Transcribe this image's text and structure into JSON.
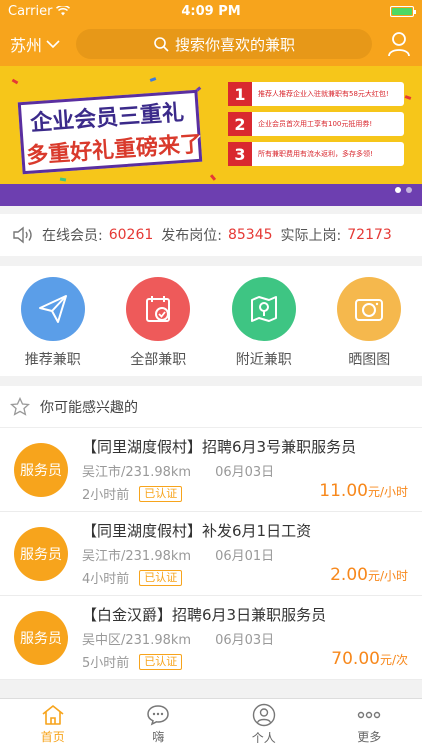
{
  "status": {
    "carrier": "Carrier",
    "time": "4:09 PM"
  },
  "header": {
    "city": "苏州",
    "search_placeholder": "搜索你喜欢的兼职"
  },
  "banner": {
    "title_line1": "企业会员三重礼",
    "title_line2": "多重好礼重磅来了",
    "items": [
      {
        "num": "1",
        "text": "推荐人推荐企业入驻就兼职有58元大红包!"
      },
      {
        "num": "2",
        "text": "企业会员首次用工享有100元抵用券!"
      },
      {
        "num": "3",
        "text": "所有兼职费用有流水返利，多存多领!"
      }
    ]
  },
  "stats": {
    "online_label": "在线会员:",
    "online_value": "60261",
    "posted_label": "发布岗位:",
    "posted_value": "85345",
    "actual_label": "实际上岗:",
    "actual_value": "72173"
  },
  "categories": [
    {
      "label": "推荐兼职",
      "color": "#5b9ee8",
      "icon": "paper-plane-icon"
    },
    {
      "label": "全部兼职",
      "color": "#ee5a5a",
      "icon": "calendar-check-icon"
    },
    {
      "label": "附近兼职",
      "color": "#3ec583",
      "icon": "map-pin-icon"
    },
    {
      "label": "晒图图",
      "color": "#f5b84d",
      "icon": "camera-icon"
    }
  ],
  "recommend": {
    "title": "你可能感兴趣的"
  },
  "jobs": [
    {
      "avatar": "服务员",
      "title": "【同里湖度假村】招聘6月3号兼职服务员",
      "location": "吴江市/231.98km",
      "date": "06月03日",
      "time": "2小时前",
      "badge": "已认证",
      "price": "11.00",
      "unit": "元/小时"
    },
    {
      "avatar": "服务员",
      "title": "【同里湖度假村】补发6月1日工资",
      "location": "吴江市/231.98km",
      "date": "06月01日",
      "time": "4小时前",
      "badge": "已认证",
      "price": "2.00",
      "unit": "元/小时"
    },
    {
      "avatar": "服务员",
      "title": "【白金汉爵】招聘6月3日兼职服务员",
      "location": "吴中区/231.98km",
      "date": "06月03日",
      "time": "5小时前",
      "badge": "已认证",
      "price": "70.00",
      "unit": "元/次"
    }
  ],
  "tabs": [
    {
      "label": "首页",
      "icon": "home-icon"
    },
    {
      "label": "嗨",
      "icon": "chat-icon"
    },
    {
      "label": "个人",
      "icon": "person-icon"
    },
    {
      "label": "更多",
      "icon": "more-icon"
    }
  ],
  "colors": {
    "brand": "#f7a41c",
    "price": "#f7881c",
    "stat_number": "#e53935"
  }
}
